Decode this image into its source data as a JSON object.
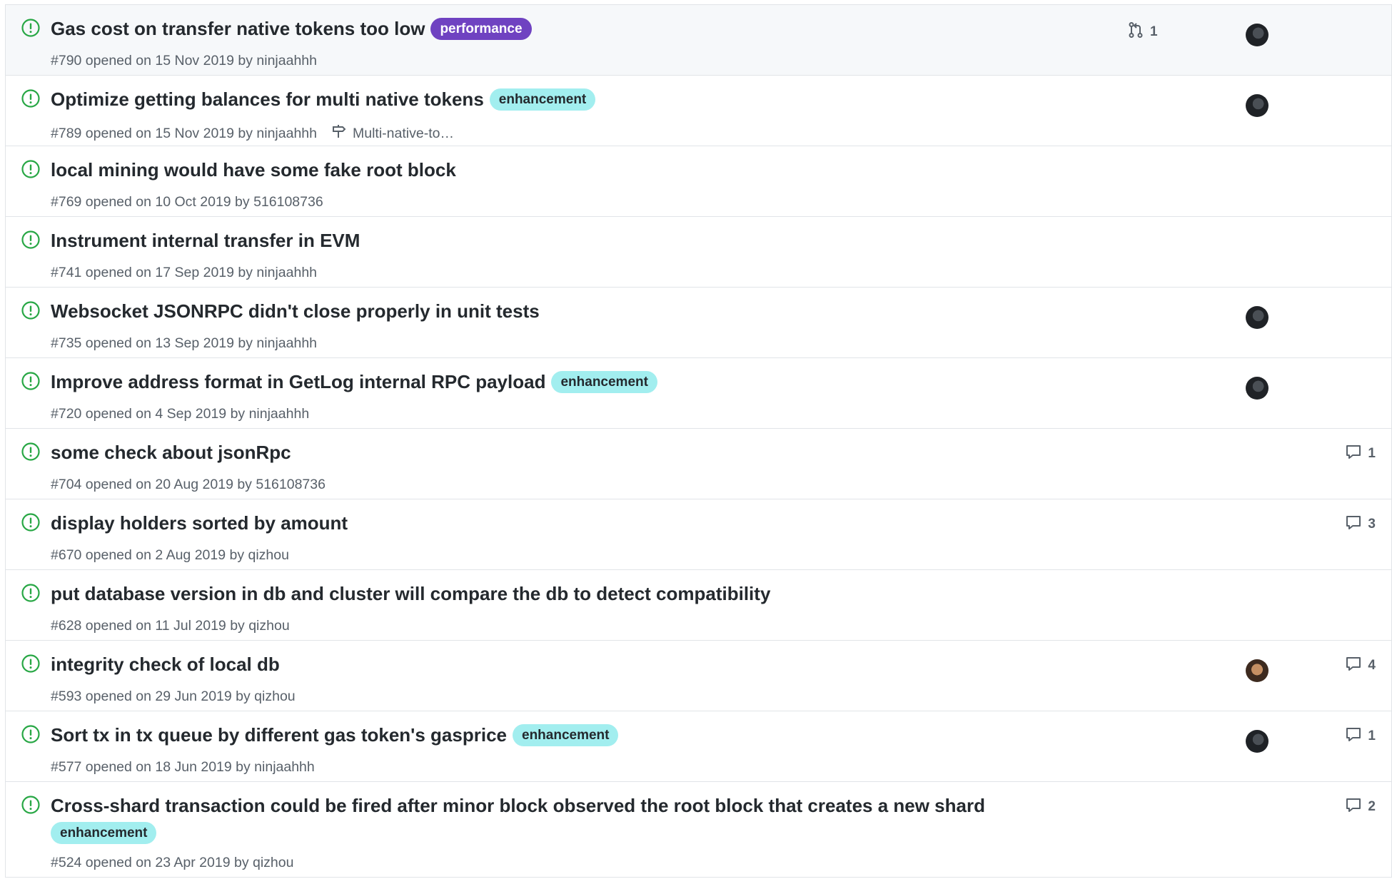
{
  "colors": {
    "open_icon": "#28a745",
    "performance_label_bg": "#6f42c1",
    "performance_label_fg": "#ffffff",
    "enhancement_label_bg": "#a2eeef",
    "enhancement_label_fg": "#24292e",
    "meta_text": "#586069",
    "row_hover_bg": "#f6f8fa"
  },
  "issues": [
    {
      "title": "Gas cost on transfer native tokens too low",
      "label": "performance",
      "meta": "#790 opened on 15 Nov 2019 by ninjaahhh",
      "linked_prs": "1",
      "avatar": "dark",
      "hovered": true
    },
    {
      "title": "Optimize getting balances for multi native tokens",
      "label": "enhancement",
      "meta": "#789 opened on 15 Nov 2019 by ninjaahhh",
      "milestone": "Multi-native-to…",
      "avatar": "dark"
    },
    {
      "title": "local mining would have some fake root block",
      "meta": "#769 opened on 10 Oct 2019 by 516108736"
    },
    {
      "title": "Instrument internal transfer in EVM",
      "meta": "#741 opened on 17 Sep 2019 by ninjaahhh"
    },
    {
      "title": "Websocket JSONRPC didn't close properly in unit tests",
      "meta": "#735 opened on 13 Sep 2019 by ninjaahhh",
      "avatar": "dark"
    },
    {
      "title": "Improve address format in GetLog internal RPC payload",
      "label": "enhancement",
      "meta": "#720 opened on 4 Sep 2019 by ninjaahhh",
      "avatar": "dark"
    },
    {
      "title": "some check about jsonRpc",
      "meta": "#704 opened on 20 Aug 2019 by 516108736",
      "comments": "1"
    },
    {
      "title": "display holders sorted by amount",
      "meta": "#670 opened on 2 Aug 2019 by qizhou",
      "comments": "3"
    },
    {
      "title": "put database version in db and cluster will compare the db to detect compatibility",
      "meta": "#628 opened on 11 Jul 2019 by qizhou"
    },
    {
      "title": "integrity check of local db",
      "meta": "#593 opened on 29 Jun 2019 by qizhou",
      "avatar": "face",
      "comments": "4"
    },
    {
      "title": "Sort tx in tx queue by different gas token's gasprice",
      "label": "enhancement",
      "meta": "#577 opened on 18 Jun 2019 by ninjaahhh",
      "avatar": "dark",
      "comments": "1"
    },
    {
      "title": "Cross-shard transaction could be fired after minor block observed the root block that creates a new shard",
      "label": "enhancement",
      "label_wrapped": true,
      "meta": "#524 opened on 23 Apr 2019 by qizhou",
      "comments": "2"
    }
  ]
}
